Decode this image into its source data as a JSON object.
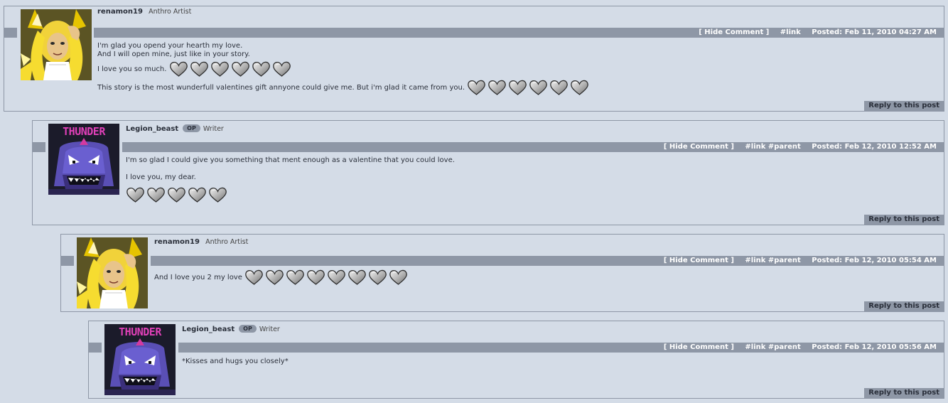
{
  "colors": {
    "page_bg": "#d4dce7",
    "bar": "#8e97a6",
    "border": "#8e97a6"
  },
  "hide_label": "[ Hide Comment ]",
  "reply_label": "Reply to this post",
  "comments": [
    {
      "username": "renamon19",
      "title": "Anthro Artist",
      "op": "",
      "avatar": "fox-avatar",
      "links": "#link",
      "posted": "Posted: Feb 11, 2010 04:27 AM",
      "lines": [
        "I'm glad you opend your hearth my love.",
        "And I will open mine, just like in your story.",
        "I love you so much.",
        "This story is the most wunderfull valentines gift annyone could give me. But i'm glad it came from you."
      ]
    },
    {
      "username": "Legion_beast",
      "title": "Writer",
      "op": "OP",
      "avatar": "thunder-avatar",
      "avatar_text": "THUNDER",
      "links": "#link #parent",
      "posted": "Posted: Feb 12, 2010 12:52 AM",
      "lines": [
        "I'm so glad I could give you something that ment enough as a valentine that you could love.",
        "I love you, my dear."
      ]
    },
    {
      "username": "renamon19",
      "title": "Anthro Artist",
      "op": "",
      "avatar": "fox-avatar",
      "links": "#link #parent",
      "posted": "Posted: Feb 12, 2010 05:54 AM",
      "lines": [
        "And I love you 2 my love"
      ]
    },
    {
      "username": "Legion_beast",
      "title": "Writer",
      "op": "OP",
      "avatar": "thunder-avatar",
      "avatar_text": "THUNDER",
      "links": "#link #parent",
      "posted": "Posted: Feb 12, 2010 05:56 AM",
      "lines": [
        "*Kisses and hugs you closely*"
      ]
    }
  ]
}
